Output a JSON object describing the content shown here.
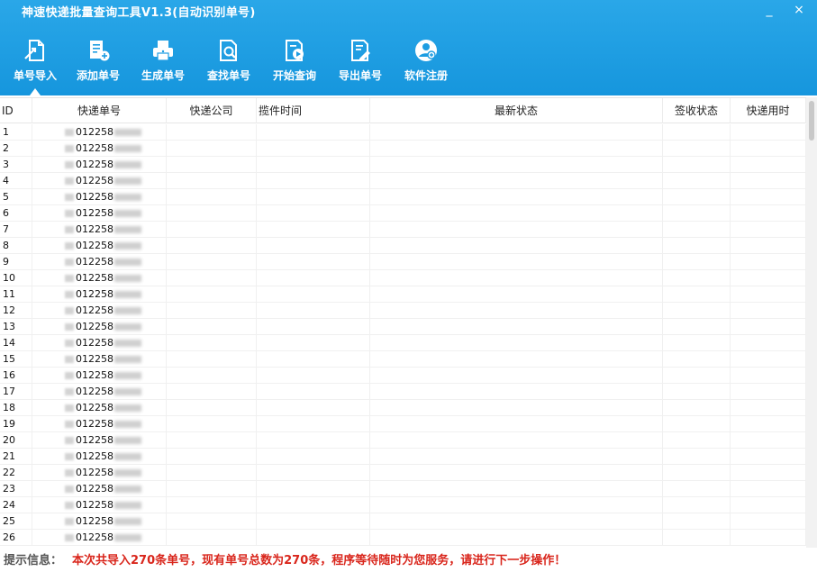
{
  "window": {
    "title": "神速快递批量查询工具V1.3(自动识别单号)",
    "min_glyph": "_",
    "close_glyph": "×"
  },
  "toolbar": [
    {
      "label": "单号导入",
      "icon": "import-icon",
      "active": true
    },
    {
      "label": "添加单号",
      "icon": "add-icon"
    },
    {
      "label": "生成单号",
      "icon": "printer-icon"
    },
    {
      "label": "查找单号",
      "icon": "search-doc-icon"
    },
    {
      "label": "开始查询",
      "icon": "play-doc-icon"
    },
    {
      "label": "导出单号",
      "icon": "export-icon"
    },
    {
      "label": "软件注册",
      "icon": "register-icon"
    }
  ],
  "table": {
    "columns": [
      "ID",
      "快递单号",
      "快递公司",
      "揽件时间",
      "最新状态",
      "签收状态",
      "快递用时"
    ],
    "rows": [
      {
        "id": "1",
        "no": "012258"
      },
      {
        "id": "2",
        "no": "012258"
      },
      {
        "id": "3",
        "no": "012258"
      },
      {
        "id": "4",
        "no": "012258"
      },
      {
        "id": "5",
        "no": "012258"
      },
      {
        "id": "6",
        "no": "012258"
      },
      {
        "id": "7",
        "no": "012258"
      },
      {
        "id": "8",
        "no": "012258"
      },
      {
        "id": "9",
        "no": "012258"
      },
      {
        "id": "10",
        "no": "012258"
      },
      {
        "id": "11",
        "no": "012258"
      },
      {
        "id": "12",
        "no": "012258"
      },
      {
        "id": "13",
        "no": "012258"
      },
      {
        "id": "14",
        "no": "012258"
      },
      {
        "id": "15",
        "no": "012258"
      },
      {
        "id": "16",
        "no": "012258"
      },
      {
        "id": "17",
        "no": "012258"
      },
      {
        "id": "18",
        "no": "012258"
      },
      {
        "id": "19",
        "no": "012258"
      },
      {
        "id": "20",
        "no": "012258"
      },
      {
        "id": "21",
        "no": "012258"
      },
      {
        "id": "22",
        "no": "012258"
      },
      {
        "id": "23",
        "no": "012258"
      },
      {
        "id": "24",
        "no": "012258"
      },
      {
        "id": "25",
        "no": "012258"
      },
      {
        "id": "26",
        "no": "012258"
      }
    ]
  },
  "status": {
    "label": "提示信息：",
    "message": "本次共导入270条单号，现有单号总数为270条，程序等待随时为您服务，请进行下一步操作！"
  },
  "colors": {
    "header": "#1d9de2",
    "status_message": "#d9261c"
  }
}
